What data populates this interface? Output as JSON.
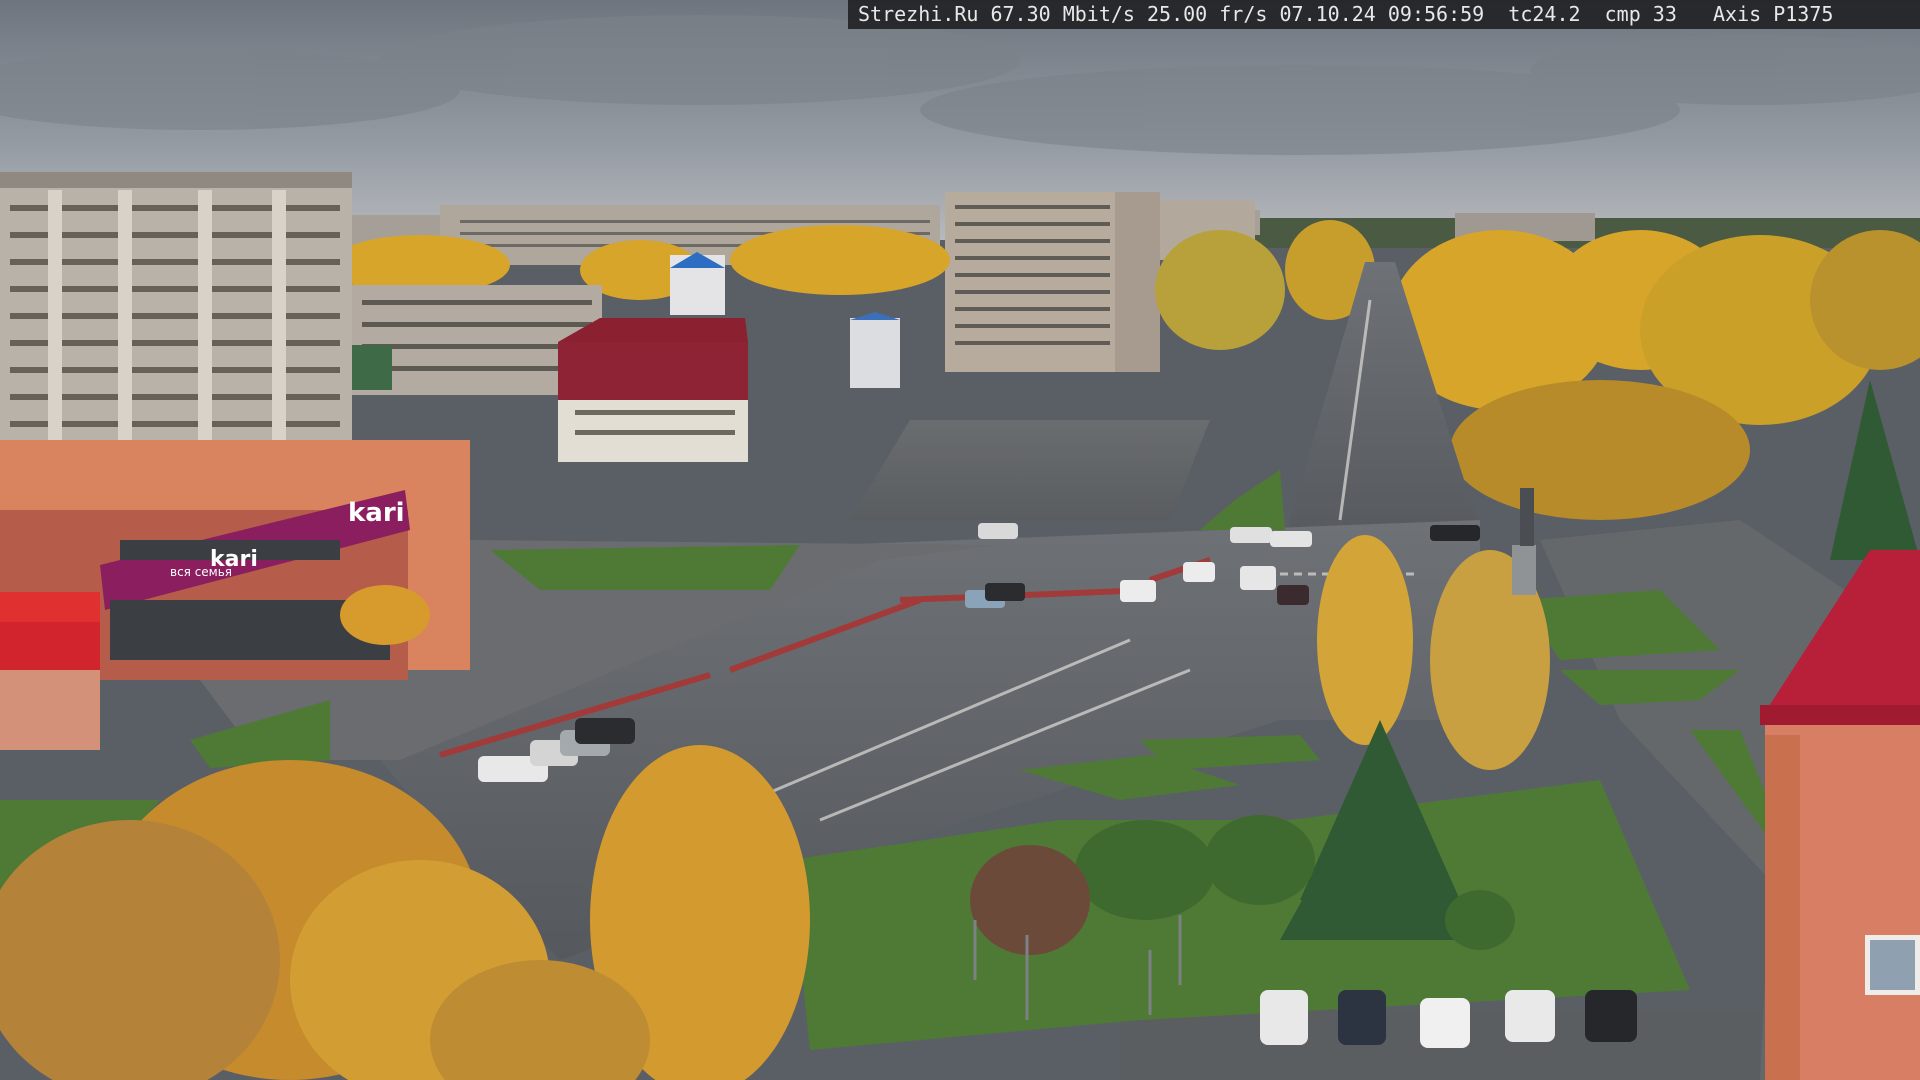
{
  "overlay": {
    "site": "Strezhi.Ru",
    "bitrate": "67.30 Mbit/s",
    "framerate": "25.00 fr/s",
    "date": "07.10.24",
    "time": "09:56:59",
    "tc": "tc24.2",
    "cmp": "cmp 33",
    "camera": "Axis P1375"
  },
  "signs": {
    "store_brand": "kari",
    "store_brand_2": "kari",
    "store_slogan": "вся семья"
  },
  "colors": {
    "sky": "#8a9099",
    "overlay_bg": "#1c1c1e",
    "overlay_text": "#e8e8e8",
    "store_sign": "#8a1e5e",
    "autumn_foliage": "#d9a62a",
    "grass": "#4f7a35",
    "asphalt": "#5d6165"
  }
}
